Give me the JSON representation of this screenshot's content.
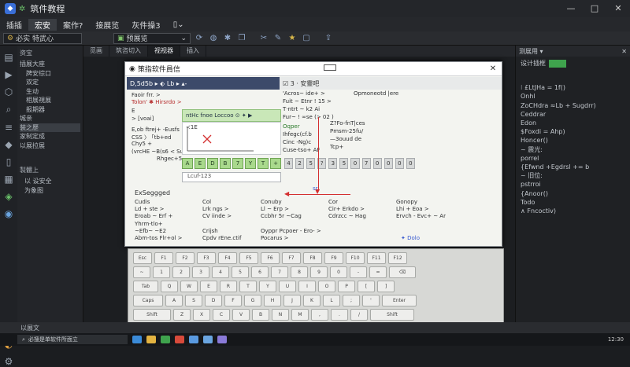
{
  "app": {
    "title": "筑件教程",
    "window_controls": [
      "—",
      "□",
      "✕"
    ]
  },
  "menubar": [
    "插插",
    "宏安",
    "案作?",
    "接展览",
    "灰件操3",
    "▯⌄"
  ],
  "toolbar": {
    "left_select": "必实 特武心",
    "mid_select": "预展览"
  },
  "explorer": {
    "header": "资宝",
    "section1": "插展大座",
    "items": [
      "牌安综口",
      "双定",
      "生动",
      "相展視展",
      "报期器",
      "城亲",
      "装之歷",
      "家制定成",
      "以展拉展"
    ],
    "section2": "製體上",
    "items2": [
      "以 设安全",
      "为象图"
    ]
  },
  "tabs": [
    "觅画",
    "筑咨切入",
    "视视器",
    "插入"
  ],
  "dialog": {
    "title": "策指软件員信",
    "tab_left": "D,5d5b ▸   ⬖ Lb ▸ ▴-",
    "tab_right": "☑ 3 · 安靈吧",
    "left_lines": [
      "Faoir frr. >",
      "Tolon' ✱ Hirsrdo >",
      "E",
      "> [voai]",
      "E,ob ftrej+ -Eusfs",
      "CSS 〉 ｢tb+ed",
      "Chy5 +",
      "(vrcHE ~B(s6 < Sugb+",
      "Rhgec+5"
    ],
    "green_box": "ntHc fnoe Loccoo ⊙  ✦  ▶",
    "plot_label": "≺1E",
    "key_row": [
      "A",
      "E",
      "D",
      "B",
      "7",
      "Y",
      "T",
      "+"
    ],
    "num_row": [
      "4",
      "2",
      "5",
      "?",
      "3",
      "5",
      "0",
      "7",
      "0",
      "0",
      "0",
      "0"
    ],
    "input_value": "Lcuf-123",
    "mid_lines": [
      "'Acros~ ide+ >",
      "Fuit ~ Etnr ! 15 >",
      "T·ntrt ~ k2 Ai",
      "Fur~ ! ∞se (> 02 )"
    ],
    "mid_right_lines": [
      "Opmoneotd |ere",
      "Z?Fo-fnT|ces",
      "Pmsm-25fu/",
      "—3ouud de",
      "Tcp+"
    ],
    "guide_lines": [
      "Oqper",
      "Ihfegc(cf.b",
      "Cinc -Ng)c",
      "Cuse-tso+ AF"
    ],
    "sr": "sr",
    "bottom_header": "ExSeggged",
    "bottom_cols": [
      [
        "Cudis",
        "Ld + ste >",
        "Eroab ~ Erf +",
        "Yhrm-tlo+",
        "~Efb~ ~E2",
        "Abm-tos Flr+ol >"
      ],
      [
        "Col",
        "Lrk ngs >",
        "CV iinde >",
        "",
        "Crijsh",
        "Cpdv rEne.ctif"
      ],
      [
        "Conuby",
        "Ll ~ Erp >",
        "Ccbhr 5r ~Cag",
        "",
        "Oyppr Pcpoer - Ero- >",
        "Pocarus >"
      ],
      [
        "Cor",
        "Cir+ Erkdo >",
        "Cdrzcc ~ Hag",
        "",
        "",
        "✦ Dolo"
      ],
      [
        "Gonopy",
        "Lhi + Eoa >",
        "Ervch - Evc+ ~ Ar",
        "",
        "",
        ""
      ]
    ]
  },
  "keyboard_rows": [
    [
      "Esc",
      "F1",
      "F2",
      "F3",
      "F4",
      "F5",
      "F6",
      "F7",
      "F8",
      "F9",
      "F10",
      "F11",
      "F12"
    ],
    [
      "~",
      "1",
      "2",
      "3",
      "4",
      "5",
      "6",
      "7",
      "8",
      "9",
      "0",
      "-",
      "=",
      "⌫"
    ],
    [
      "Tab",
      "Q",
      "W",
      "E",
      "R",
      "T",
      "Y",
      "U",
      "I",
      "O",
      "P",
      "[",
      "]"
    ],
    [
      "Caps",
      "A",
      "S",
      "D",
      "F",
      "G",
      "H",
      "J",
      "K",
      "L",
      ";",
      "'",
      "Enter"
    ],
    [
      "Shift",
      "Z",
      "X",
      "C",
      "V",
      "B",
      "N",
      "M",
      ",",
      ".",
      "/",
      "Shift"
    ]
  ],
  "right_panel": {
    "header": "测展用 ▾",
    "search": "设计插框",
    "lines": [
      "⁝ £LtJHa = 1f()",
      "",
      "  Onhl",
      "    ZoCHdra ≈Lb + Sugdrr)",
      "    Ceddrar",
      "",
      "  Edon",
      "    $Foxdi = Ahp)",
      "    Honcer()",
      "",
      "~ 震光:",
      "    porrel",
      "    {Efwnd +Egdrsl += b",
      "",
      "~ 旧位:",
      "    pstrroi",
      "    {Anoor()",
      "",
      "  Todo",
      "    ∧ Fncoctiv)"
    ]
  },
  "status": "以展文",
  "taskbar": {
    "search": "必搜是单软件所面立",
    "clock": "12:30"
  }
}
